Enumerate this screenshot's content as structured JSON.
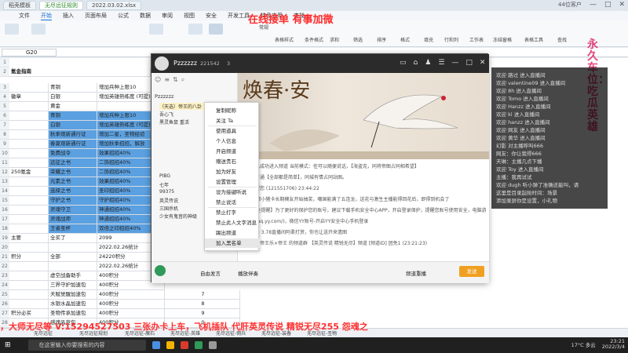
{
  "browser": {
    "tabs": [
      {
        "label": "稻壳模板",
        "active": false
      },
      {
        "label": "无尽远征规则",
        "active": true
      },
      {
        "label": "2022.03.02.xlsx",
        "active": false
      }
    ],
    "user": "44位客户"
  },
  "menubar": [
    "文件",
    "开始",
    "插入",
    "页面布局",
    "公式",
    "数据",
    "审阅",
    "视图",
    "安全",
    "开发工具",
    "特色应用",
    "查找"
  ],
  "ribbon": {
    "labels": [
      "常规",
      "表格样式",
      "条件格式",
      "求和",
      "筛选",
      "排序",
      "格式",
      "填充",
      "行和列",
      "工作表",
      "冻结窗格",
      "表格工具",
      "查找"
    ]
  },
  "namebox": "G20",
  "sheet": {
    "title": "氪金指南",
    "rows": [
      {
        "a": "",
        "b": "青铜",
        "c": "增加兵种上限10"
      },
      {
        "a": "徽章",
        "b": "白银",
        "c": "增加英雄熟练度 (可提)"
      },
      {
        "a": "",
        "b": "黄金",
        "c": ""
      },
      {
        "a": "",
        "b": "青铜",
        "c": "增加兵种上限10"
      },
      {
        "a": "",
        "b": "白银",
        "c": "增加英雄熟练度 (可提)"
      },
      {
        "a": "",
        "b": "秋季观新通行证",
        "c": "增加二星，圣物经验"
      },
      {
        "a": "",
        "b": "春夏观新通行证",
        "c": "增加秋季招招，解放"
      },
      {
        "a": "",
        "b": "免费战令",
        "c": "效果招招40%"
      },
      {
        "a": "",
        "b": "远征之书",
        "c": "二饰招招40%"
      },
      {
        "a": "250氪金",
        "b": "荣耀之书",
        "c": "二饰招招40%"
      },
      {
        "a": "",
        "b": "元素之书",
        "c": "效果招招40%"
      },
      {
        "a": "",
        "b": "选择之书",
        "c": "圣印招招40%"
      },
      {
        "a": "",
        "b": "守护之书",
        "c": "守护招招40%"
      },
      {
        "a": "",
        "b": "灵魂守卫",
        "c": "神通招招40%"
      },
      {
        "a": "",
        "b": "灵魂战师",
        "c": "神通招招40%"
      },
      {
        "a": "",
        "b": "王者圣杯",
        "c": "双倍之印招招40%"
      },
      {
        "a": "主要",
        "b": "全买了",
        "c": "2099"
      },
      {
        "a": "",
        "b": "",
        "c": "2022.02.26统计"
      },
      {
        "a": "积分",
        "b": "全部",
        "c": "24220积分"
      },
      {
        "a": "",
        "b": "",
        "c": "2022.02.26统计"
      },
      {
        "a": "",
        "b": "虚空战备助手",
        "c": "400积分"
      },
      {
        "a": "",
        "b": "三界守护加速包",
        "c": "400积分"
      },
      {
        "a": "",
        "b": "天赋觉醒加速包",
        "c": "400积分"
      },
      {
        "a": "",
        "b": "水银水晶加速包",
        "c": "400积分"
      },
      {
        "a": "积分必买",
        "b": "圣物传承加速包",
        "c": "400积分"
      },
      {
        "a": "",
        "b": "感魂晶竞包",
        "c": "400积分"
      },
      {
        "a": "",
        "b": "英雄的战斗手册",
        "c": "400积分"
      }
    ],
    "row_numbers": [
      "1",
      "2",
      "3",
      "4",
      "5",
      "6",
      "7",
      "8",
      "9",
      "10",
      "11",
      "12",
      "13",
      "14",
      "15",
      "16",
      "17",
      "18",
      "19",
      "20",
      "21",
      "22",
      "23",
      "24",
      "25",
      "26",
      "27",
      "28",
      "29"
    ],
    "side_numbers": [
      "7",
      "8",
      "9",
      "0"
    ]
  },
  "sheet_tabs": [
    "无尽远征",
    "无尽远征规划",
    "无尽远征-魔石",
    "无尽远征-英雄",
    "无尽远征-佣兵",
    "无尽远征-装备",
    "无尽远征-圣物"
  ],
  "overlay": {
    "top": "在线接单 有事加微",
    "right_vertical": "永久车位：吃瓜英雄",
    "bottom": "，大师无尽等    V:15294527503    三张办卡上车，飞机插队    代肝英灵传说 精锐无尽255 怨魂之"
  },
  "yy": {
    "channel_name": "Pzzzzzz",
    "channel_id": "221542",
    "viewer_count": "3",
    "tree_header": "Pzzzzzz",
    "tree_items": [
      "（天选）帝王的八卦",
      "吾心飞",
      "黑灵鱼鼠 重活",
      "PIBG",
      "七年",
      "99375",
      "英灵传说",
      "三国杀机",
      "少女有鬼音的神级"
    ],
    "banner_text": "焕春·安",
    "chat_lines": [
      {
        "name": "系统",
        "text": "你已成功进入频道 当前模式：任可以随便说话，【海盗克，同将帝图占同相希望】"
      },
      {
        "name": "",
        "text": "频道已开通【全部都是简单】，同城有情占同站图。"
      },
      {
        "name": "系统",
        "text": "提醒您 (121551706) 23:44:22"
      },
      {
        "name": "",
        "text": "【YY】那小猪卡长期模友开始抽奖，嘲国能满了五连龙，送花与激生主播能得回花后，即得到机会了"
      },
      {
        "name": "",
        "text": "【YY安全提醒】为了更好的保护您的账号，建议下载手机安全中心APP，开启登录保护，提醒您账号使用安全，电脑游打开YY安全中心"
      },
      {
        "name": "",
        "text": "(http://aq.yy.com/)，微信YY账号-开启YY安全中心手机登录"
      },
      {
        "name": "",
        "text": "(78217) 3.78直播间阿柔打赏，你也让送开来遗图"
      },
      {
        "name": "",
        "text": "【天选】帝王乐×帝王 的频道群 【英灵传说 精锐无尽】频道 [频道ID] 团免1 (23:21:23)"
      }
    ],
    "context_menu": [
      "复制昵称",
      "关注 Ta",
      "使用道具",
      "个人信息",
      "开启频道",
      "赠送贵石",
      "加为好友",
      "设置管理",
      "设为接键听说",
      "禁止说话",
      "禁止打字",
      "禁止此人文字消息",
      "踢出频道",
      "加入黑名单"
    ],
    "bottom_bar": [
      "自由发言",
      "播放伴奏",
      "频道重播",
      "发送"
    ],
    "input_placeholder": "输入消息..."
  },
  "stream_chat": [
    "欢迎 路过 进入直播间",
    "欢迎 valentine09 进入直播间",
    "欢迎 8h 进入直播间",
    "欢迎 Tomo 进入直播间",
    "欢迎 Hanzz 进入直播间",
    "欢迎 kl 进入直播间",
    "欢迎 hanzz 进入直播间",
    "欢迎 网友 进入直播间",
    "欢迎 黄华 进入直播间",
    "幻影 对主播呼叫666",
    "网友：你让我得666",
    "天琳：主播几点下播",
    "欢迎 Toy 进入直播间",
    "主播：我再试试",
    "欢迎 dugh 听小弹了准确还能叫，请",
    "这里是目录起始时间：场景",
    "添加录屏你是设置，小礼物"
  ],
  "taskbar": {
    "search_placeholder": "在这里输入你要搜索的内容",
    "weather": "17°C 多云",
    "time": "23:21",
    "date": "2022/3/4"
  }
}
